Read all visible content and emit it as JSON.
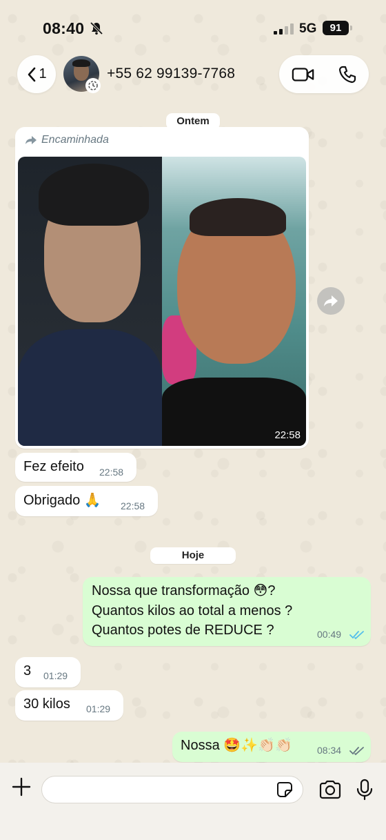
{
  "status_bar": {
    "time": "08:40",
    "network": "5G",
    "battery": "91"
  },
  "header": {
    "back_count": "1",
    "contact": "+55 62 99139-7768"
  },
  "chat": {
    "date_yesterday": "Ontem",
    "forwarded_label": "Encaminhada",
    "photo_time": "22:58",
    "msg1": {
      "text": "Fez efeito",
      "time": "22:58"
    },
    "msg2": {
      "text": "Obrigado 🙏",
      "time": "22:58"
    },
    "date_today": "Hoje",
    "msg3": {
      "line1": "Nossa que transformação 😳?",
      "line2": "Quantos kilos ao total a menos ?",
      "line3": "Quantos potes de REDUCE ?",
      "time": "00:49"
    },
    "msg4": {
      "text": "3",
      "time": "01:29"
    },
    "msg5": {
      "text": "30 kilos",
      "time": "01:29"
    },
    "msg6": {
      "text": "Nossa 🤩✨👏🏻👏🏻",
      "time": "08:34"
    }
  },
  "colors": {
    "outgoing_bubble": "#d9fdd3",
    "incoming_bubble": "#ffffff",
    "read_tick": "#53bdeb",
    "background": "#efe9dc"
  }
}
